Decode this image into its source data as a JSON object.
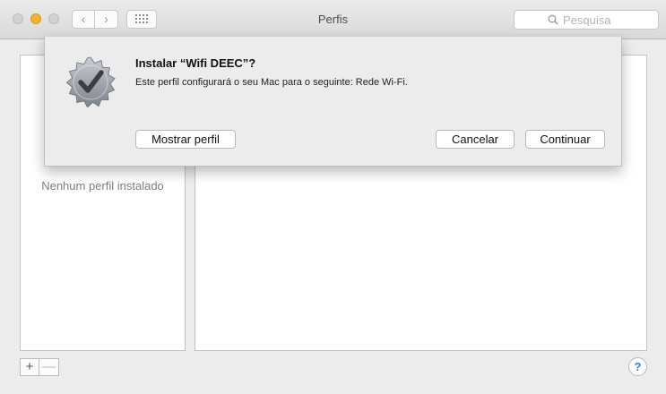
{
  "window": {
    "title": "Perfis",
    "nav_back_glyph": "‹",
    "nav_forward_glyph": "›",
    "grid_icon": "grid-icon"
  },
  "search": {
    "placeholder": "Pesquisa",
    "icon": "search-icon"
  },
  "profiles_list": {
    "empty_text": "Nenhum perfil instalado"
  },
  "controls": {
    "add_label": "+",
    "remove_label": "—",
    "help_label": "?"
  },
  "sheet": {
    "icon": "checkmark-badge-icon",
    "title": "Instalar “Wifi DEEC”?",
    "message": "Este perfil configurará o seu Mac para o seguinte: Rede Wi-Fi.",
    "buttons": {
      "show_profile": "Mostrar perfil",
      "cancel": "Cancelar",
      "continue": "Continuar"
    }
  },
  "colors": {
    "window_bg": "#ececec",
    "minimize_yellow": "#f5b02e",
    "help_blue": "#2f7ae5"
  }
}
